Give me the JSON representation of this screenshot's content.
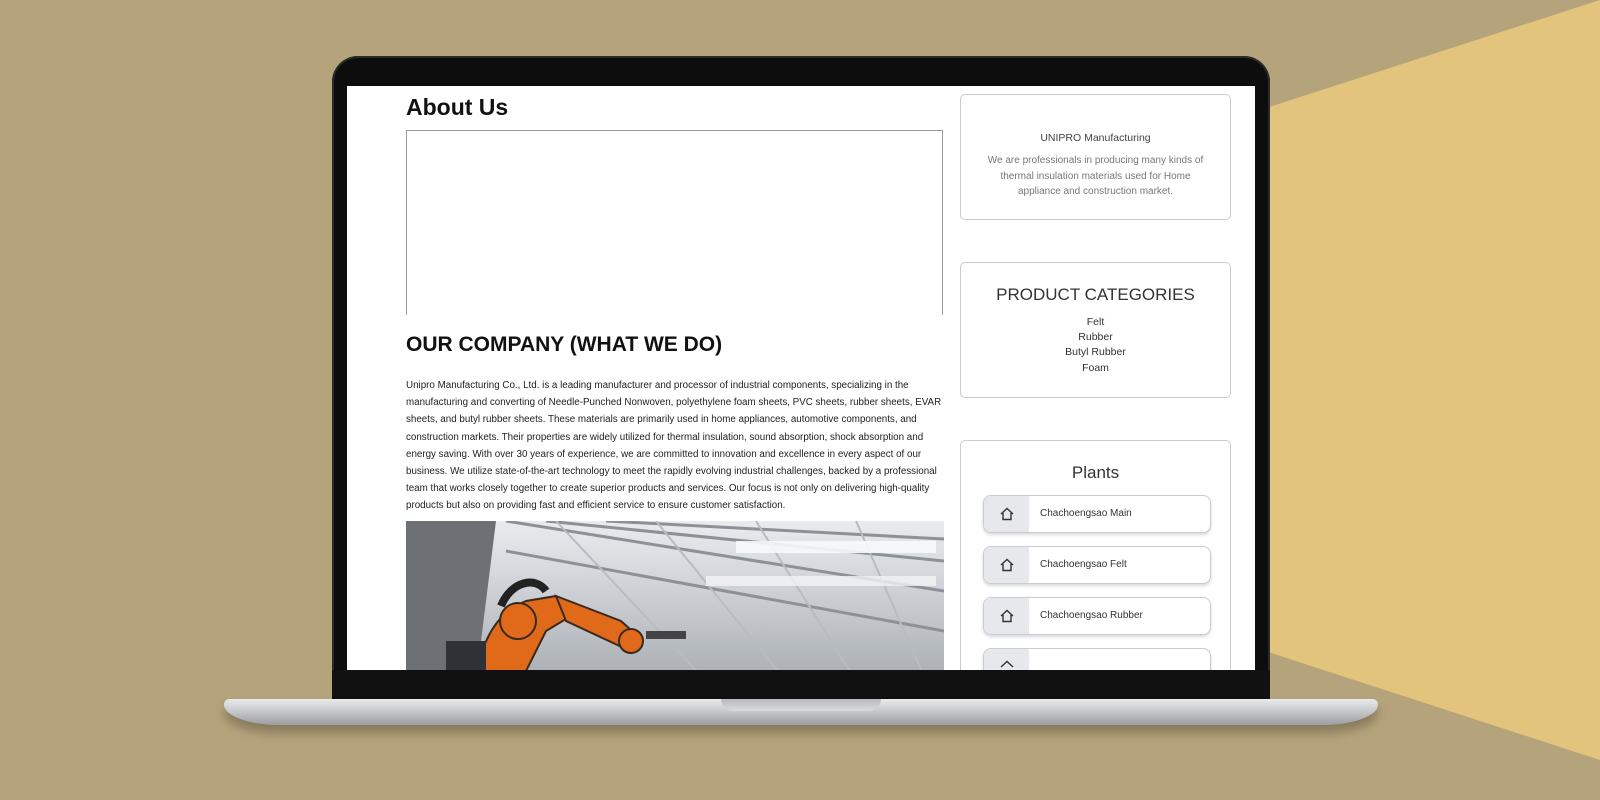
{
  "page": {
    "about_title": "About Us",
    "company_title": "OUR COMPANY (WHAT WE DO)",
    "company_text": "Unipro Manufacturing Co., Ltd. is a leading manufacturer and processor of industrial components, specializing in the manufacturing and converting of Needle-Punched Nonwoven, polyethylene foam sheets, PVC sheets, rubber sheets, EVAR sheets, and butyl rubber sheets. These materials are primarily used in home appliances, automotive components, and construction markets. Their properties are widely utilized for thermal insulation, sound absorption, shock absorption and energy saving. With over 30 years of experience, we are committed to innovation and excellence in every aspect of our business. We utilize state-of-the-art technology to meet the rapidly evolving industrial challenges, backed by a professional team that works closely together to create superior products and services. Our focus is not only on delivering high-quality products but also on providing fast and efficient service to ensure customer satisfaction."
  },
  "sidebar": {
    "company_name": "UNIPRO Manufacturing",
    "company_desc": "We are professionals in producing many kinds of thermal insulation materials used for Home appliance and construction market.",
    "categories_title": "PRODUCT CATEGORIES",
    "categories": [
      "Felt",
      "Rubber",
      "Butyl Rubber",
      "Foam"
    ],
    "plants_title": "Plants",
    "plants": [
      "Chachoengsao Main",
      "Chachoengsao Felt",
      "Chachoengsao Rubber"
    ]
  },
  "colors": {
    "backdrop": "#b5a37b",
    "backdrop_accent": "#e3c47c",
    "robot_orange": "#e06a1a"
  }
}
